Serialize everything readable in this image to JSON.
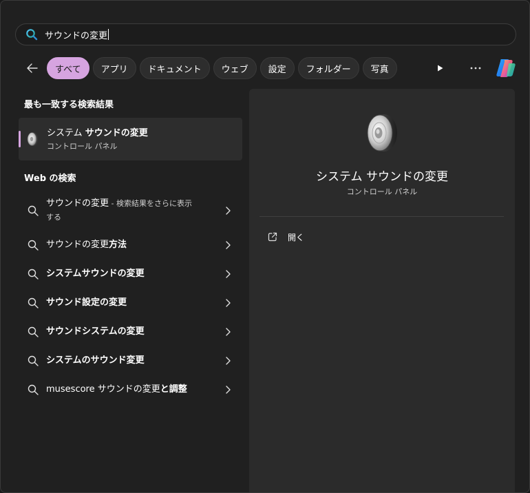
{
  "search": {
    "query": "サウンドの変更",
    "icon": "search-icon"
  },
  "toolbar": {
    "filters": [
      "すべて",
      "アプリ",
      "ドキュメント",
      "ウェブ",
      "設定",
      "フォルダー",
      "写真"
    ],
    "active_filter": "すべて",
    "accent_color": "#d6a4e0"
  },
  "left": {
    "best_match_heading": "最も一致する検索結果",
    "best_match": {
      "title_plain": "システム ",
      "title_bold": "サウンドの変更",
      "subtitle": "コントロール パネル"
    },
    "web_heading": "Web の検索",
    "web_results": [
      {
        "plain": "サウンドの変更",
        "bold": "",
        "sub": " - 検索結果をさらに表示する"
      },
      {
        "plain": "サウンドの変更",
        "bold": "方法",
        "sub": ""
      },
      {
        "plain": "",
        "bold": "システムサウンドの変更",
        "sub": ""
      },
      {
        "plain": "",
        "bold": "サウンド設定の変更",
        "sub": ""
      },
      {
        "plain": "",
        "bold": "サウンドシステムの変更",
        "sub": ""
      },
      {
        "plain": "",
        "bold": "システムのサウンド変更",
        "sub": ""
      },
      {
        "plain": "musescore サウンドの変更",
        "bold": "と調整",
        "sub": "",
        "lead_bold": "musescore"
      }
    ]
  },
  "preview": {
    "title": "システム サウンドの変更",
    "subtitle": "コントロール パネル",
    "open_label": "開く"
  }
}
